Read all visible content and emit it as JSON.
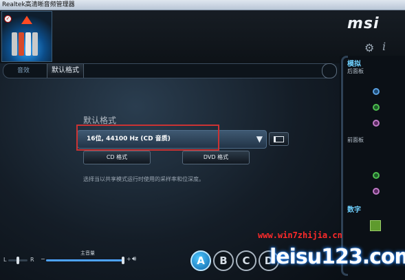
{
  "window": {
    "title": "Realtek高清晰音频管理器"
  },
  "brand": {
    "logo_text": "msi"
  },
  "header": {
    "settings_icon": "gear-icon",
    "info_icon": "info-icon"
  },
  "tabs": [
    {
      "label": "音效",
      "active": false
    },
    {
      "label": "默认格式",
      "active": true
    }
  ],
  "default_format": {
    "section_title": "默认格式",
    "selected": "16位, 44100 Hz (CD 音质)",
    "cd_button": "CD 格式",
    "dvd_button": "DVD 格式",
    "description": "选择当以共享模式运行时使用的采样率和位深度。"
  },
  "volume": {
    "label": "主音量",
    "balance_left": "L",
    "balance_right": "R",
    "plus": "+",
    "minus": "−",
    "level": 0.98,
    "balance": 0.5
  },
  "profiles": [
    "A",
    "B",
    "C",
    "D"
  ],
  "sidebar": {
    "analog": "模拟",
    "rear_panel": "后面板",
    "front_panel": "前面板",
    "digital": "数字"
  },
  "watermark": {
    "site": "www.win7zhijia.cn",
    "logo": "leisu123.com"
  },
  "colors": {
    "accent": "#4da3ff",
    "highlight_box": "#cc3333",
    "digital_icon": "#5e9a2d"
  }
}
